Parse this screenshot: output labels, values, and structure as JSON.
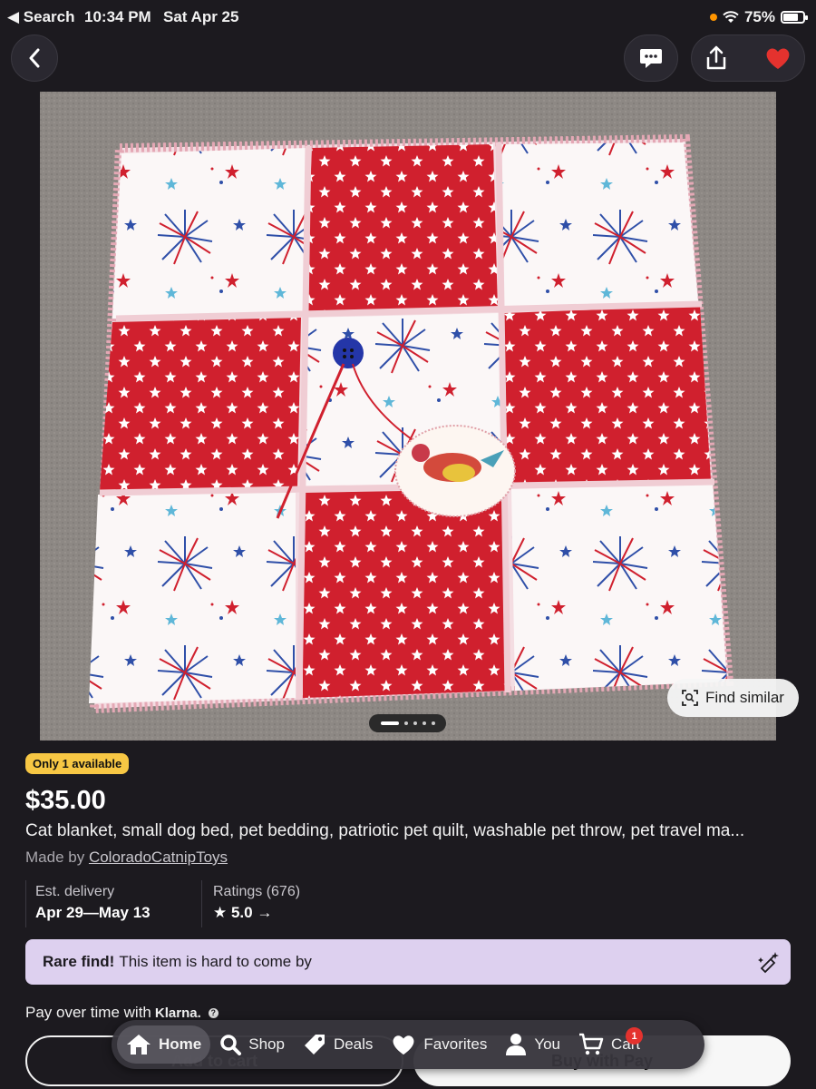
{
  "status_bar": {
    "back_app": "◀ Search",
    "time": "10:34 PM",
    "date": "Sat Apr 25",
    "battery": "75%",
    "battery_level": 0.75
  },
  "nav": {
    "icons": [
      "back-chevron-icon",
      "chat-icon",
      "share-icon",
      "heart-icon"
    ],
    "heart_color": "#e4322e"
  },
  "image": {
    "find_similar_label": "Find similar",
    "pager": {
      "total": 5,
      "current": 1
    }
  },
  "listing": {
    "availability_badge": "Only 1 available",
    "price": "$35.00",
    "title": "Cat blanket, small dog bed, pet bedding, patriotic pet quilt, washable pet throw, pet travel ma...",
    "made_by_prefix": "Made by ",
    "seller": "ColoradoCatnipToys",
    "delivery_label": "Est. delivery",
    "delivery_value": "Apr 29—May 13",
    "ratings_label": "Ratings (676)",
    "rating_value": "★ 5.0 →",
    "rare_bold": "Rare find!",
    "rare_text": "This item is hard to come by",
    "klarna_prefix": "Pay over time with",
    "klarna_brand": "Klarna.",
    "klarna_info": "?",
    "add_to_cart_label": "Add to cart",
    "buy_label": "Buy with Pay"
  },
  "tabbar": {
    "tabs": [
      {
        "label": "Home",
        "icon": "home-icon",
        "active": true
      },
      {
        "label": "Shop",
        "icon": "search-icon",
        "active": false
      },
      {
        "label": "Deals",
        "icon": "tag-icon",
        "active": false
      },
      {
        "label": "Favorites",
        "icon": "heart-icon",
        "active": false
      },
      {
        "label": "You",
        "icon": "person-icon",
        "active": false
      },
      {
        "label": "Cart",
        "icon": "cart-icon",
        "active": false,
        "badge": "1"
      }
    ]
  },
  "colors": {
    "background": "#1c1a1f",
    "badge_yellow": "#f7c744",
    "rare_bg": "#ddd0ef",
    "quilt_red": "#d0202e"
  }
}
